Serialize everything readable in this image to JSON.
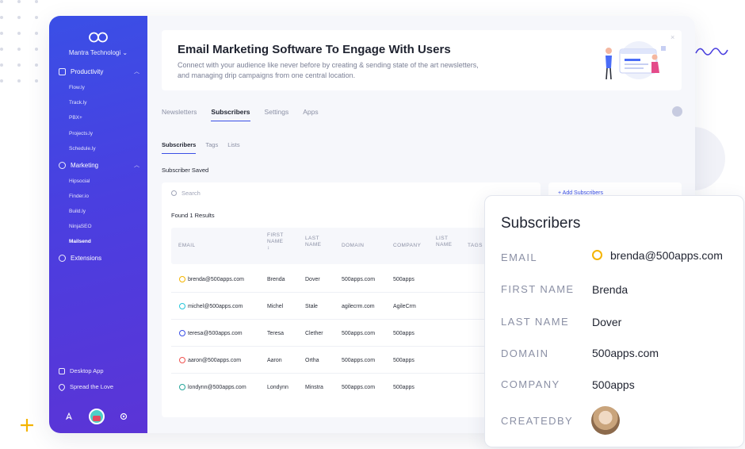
{
  "sidebar": {
    "org_name": "Mantra Technologi",
    "sections": [
      {
        "label": "Productivity",
        "icon": "command-icon",
        "items": [
          "Flow.ly",
          "Track.ly",
          "PBX+",
          "Projects.ly",
          "Schedule.ly"
        ]
      },
      {
        "label": "Marketing",
        "icon": "globe-icon",
        "items": [
          "Hipsocial",
          "Finder.io",
          "Build.ly",
          "NinjaSEO",
          "Mailsend"
        ]
      },
      {
        "label": "Extensions",
        "icon": "extensions-icon",
        "items": []
      }
    ],
    "active_item": "Mailsend",
    "bottom": [
      "Desktop App",
      "Spread the Love"
    ]
  },
  "banner": {
    "title": "Email Marketing Software To Engage With Users",
    "description": "Connect with your audience like never before by creating & sending state of the art newsletters, and managing drip campaigns from one central location.",
    "close": "×"
  },
  "tabs": [
    "Newsletters",
    "Subscribers",
    "Settings",
    "Apps"
  ],
  "active_tab": "Subscribers",
  "subtabs": [
    "Subscribers",
    "Tags",
    "Lists"
  ],
  "active_subtab": "Subscribers",
  "saved_title": "Subscriber Saved",
  "search_placeholder": "Search",
  "found_text": "Found 1 Results",
  "add_subscribers": "+ Add Subscribers",
  "table": {
    "headers": {
      "email": "EMAIL",
      "first_name": "FIRST\nNAME\n↕",
      "last_name": "LAST\nNAME",
      "domain": "DOMAIN",
      "company": "COMPANY",
      "list_name": "LIST\nNAME",
      "tags": "TAGS"
    },
    "rows": [
      {
        "email": "brenda@500apps.com",
        "first": "Brenda",
        "last": "Dover",
        "domain": "500apps.com",
        "company": "500apps",
        "color": "#f4b400"
      },
      {
        "email": "michel@500apps.com",
        "first": "Michel",
        "last": "Stale",
        "domain": "agilecrm.com",
        "company": "AgileCrm",
        "color": "#26c6da"
      },
      {
        "email": "teresa@500apps.com",
        "first": "Teresa",
        "last": "Clether",
        "domain": "500apps.com",
        "company": "500apps",
        "color": "#3a4fe6"
      },
      {
        "email": "aaron@500apps.com",
        "first": "Aaron",
        "last": "Ortha",
        "domain": "500apps.com",
        "company": "500apps",
        "color": "#ef5350"
      },
      {
        "email": "londynn@500apps.com",
        "first": "Londynn",
        "last": "Minstra",
        "domain": "500apps.com",
        "company": "500apps",
        "color": "#26a69a"
      }
    ]
  },
  "card": {
    "title": "Subscribers",
    "fields": [
      {
        "label": "EMAIL",
        "value": "brenda@500apps.com"
      },
      {
        "label": "FIRST NAME",
        "value": "Brenda"
      },
      {
        "label": "LAST NAME",
        "value": "Dover"
      },
      {
        "label": "DOMAIN",
        "value": "500apps.com"
      },
      {
        "label": "COMPANY",
        "value": "500apps"
      },
      {
        "label": "CREATEDBY",
        "value": ""
      }
    ],
    "email_ring_color": "#f4b400"
  },
  "colors": {
    "accent": "#3a4fe6",
    "sidebar_start": "#3a4fe6",
    "sidebar_end": "#5b34d6"
  }
}
